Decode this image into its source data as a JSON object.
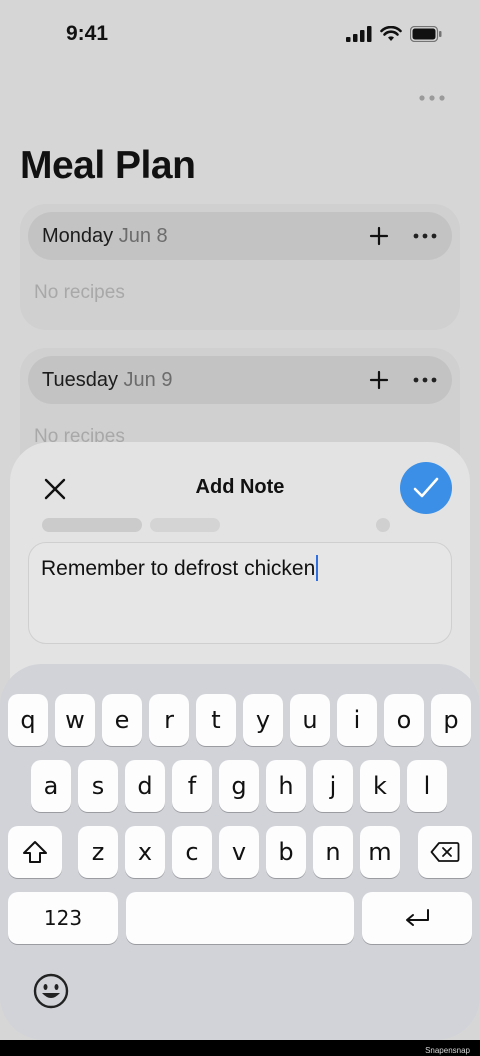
{
  "status_bar": {
    "time": "9:41"
  },
  "page": {
    "title": "Meal Plan"
  },
  "days": [
    {
      "name": "Monday",
      "date": "Jun 8",
      "empty_text": "No recipes"
    },
    {
      "name": "Tuesday",
      "date": "Jun 9",
      "empty_text": "No recipes"
    }
  ],
  "sheet": {
    "title": "Add Note",
    "note_text": "Remember to defrost chicken"
  },
  "keyboard": {
    "row1": [
      "q",
      "w",
      "e",
      "r",
      "t",
      "y",
      "u",
      "i",
      "o",
      "p"
    ],
    "row2": [
      "a",
      "s",
      "d",
      "f",
      "g",
      "h",
      "j",
      "k",
      "l"
    ],
    "row3": [
      "z",
      "x",
      "c",
      "v",
      "b",
      "n",
      "m"
    ],
    "numbers_label": "123"
  },
  "colors": {
    "accent": "#3b8fe6",
    "background": "#d6d6d6"
  },
  "watermark": "Snapensnap"
}
